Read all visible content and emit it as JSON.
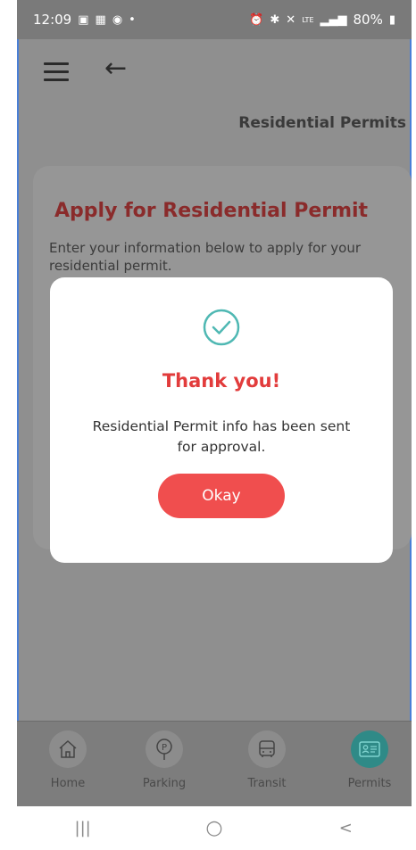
{
  "status_bar": {
    "time": "12:09",
    "left_icons": [
      "image-icon",
      "calendar-icon",
      "clock-icon",
      "dot-icon"
    ],
    "right_icons": [
      "alarm-icon",
      "bluetooth-icon",
      "mute-icon",
      "lte-icon",
      "signal-icon"
    ],
    "battery": "80%"
  },
  "header": {
    "title": "Residential Permits",
    "menu_icon": "hamburger-menu-icon",
    "back_icon": "back-arrow-icon"
  },
  "form": {
    "title": "Apply for Residential Permit",
    "description": "Enter your information below to apply for your residential permit."
  },
  "modal": {
    "icon": "check-circle-icon",
    "title": "Thank you!",
    "message": "Residential Permit info has been sent for approval.",
    "button_label": "Okay",
    "colors": {
      "accent": "#f04e4e",
      "check": "#4fb8b3"
    }
  },
  "bottom_nav": {
    "items": [
      {
        "label": "Home",
        "icon": "home-icon",
        "active": false
      },
      {
        "label": "Parking",
        "icon": "parking-meter-icon",
        "active": false
      },
      {
        "label": "Transit",
        "icon": "bus-icon",
        "active": false
      },
      {
        "label": "Permits",
        "icon": "id-card-icon",
        "active": true
      }
    ]
  },
  "system_nav": {
    "recents": "|||",
    "home": "○",
    "back": "<"
  }
}
